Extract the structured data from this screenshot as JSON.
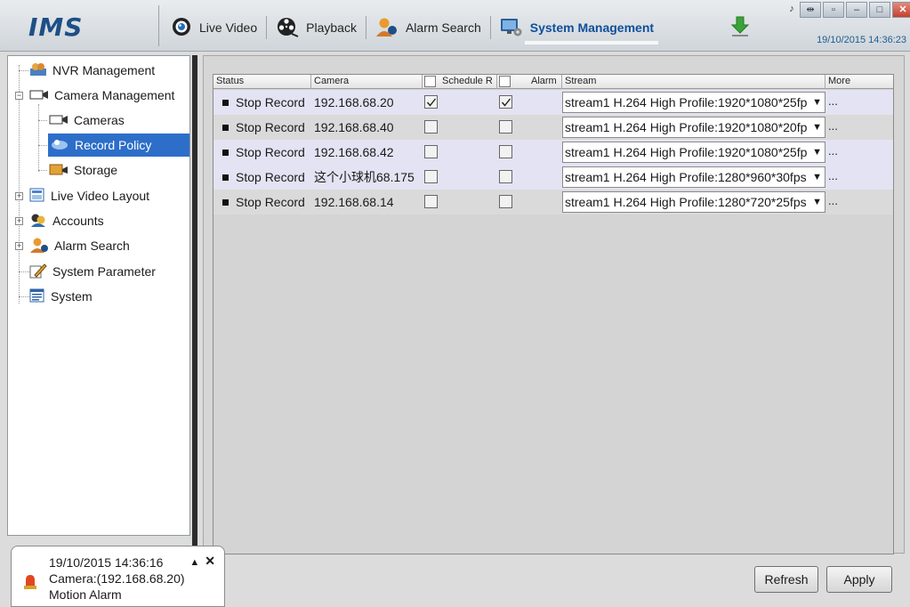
{
  "app": {
    "logo": "IMS",
    "datetime": "19/10/2015 14:36:23"
  },
  "nav": {
    "items": [
      {
        "label": "Live Video",
        "icon": "camera-eye-icon"
      },
      {
        "label": "Playback",
        "icon": "film-reel-icon"
      },
      {
        "label": "Alarm Search",
        "icon": "alarm-person-icon"
      },
      {
        "label": "System Management",
        "icon": "monitor-gear-icon",
        "active": true
      }
    ],
    "download_icon": "download-arrow-icon"
  },
  "window_controls": [
    "?",
    "▭▭",
    "▭",
    "–",
    "□",
    "X"
  ],
  "sidebar": {
    "items": [
      {
        "label": "NVR Management",
        "icon": "nvr-users-icon"
      },
      {
        "label": "Camera Management",
        "icon": "camera-icon",
        "expanded": true
      },
      {
        "label": "Cameras",
        "icon": "camera-icon"
      },
      {
        "label": "Record Policy",
        "icon": "record-policy-icon",
        "selected": true
      },
      {
        "label": "Storage",
        "icon": "storage-icon"
      },
      {
        "label": "Live Video Layout",
        "icon": "layout-icon"
      },
      {
        "label": "Accounts",
        "icon": "accounts-icon"
      },
      {
        "label": "Alarm Search",
        "icon": "alarm-person-icon"
      },
      {
        "label": "System Parameter",
        "icon": "pencil-icon"
      },
      {
        "label": "System",
        "icon": "system-window-icon"
      }
    ]
  },
  "table": {
    "headers": {
      "status": "Status",
      "camera": "Camera",
      "schedule": "Schedule R",
      "alarm": "Alarm",
      "stream": "Stream",
      "more": "More"
    },
    "rows": [
      {
        "status": "Stop Record",
        "camera": "192.168.68.20",
        "schedule": true,
        "alarm": true,
        "stream": "stream1 H.264 High Profile:1920*1080*25fp",
        "more": "..."
      },
      {
        "status": "Stop Record",
        "camera": "192.168.68.40",
        "schedule": false,
        "alarm": false,
        "stream": "stream1 H.264 High Profile:1920*1080*20fp",
        "more": "..."
      },
      {
        "status": "Stop Record",
        "camera": "192.168.68.42",
        "schedule": false,
        "alarm": false,
        "stream": "stream1 H.264 High Profile:1920*1080*25fp",
        "more": "..."
      },
      {
        "status": "Stop Record",
        "camera": "这个小球机68.175",
        "schedule": false,
        "alarm": false,
        "stream": "stream1 H.264 High Profile:1280*960*30fps",
        "more": "..."
      },
      {
        "status": "Stop Record",
        "camera": "192.168.68.14",
        "schedule": false,
        "alarm": false,
        "stream": "stream1 H.264 High Profile:1280*720*25fps",
        "more": "..."
      }
    ]
  },
  "buttons": {
    "refresh": "Refresh",
    "apply": "Apply"
  },
  "alarm_popup": {
    "time": "19/10/2015 14:36:16",
    "camera": "Camera:(192.168.68.20)",
    "message": "Motion Alarm",
    "controls": {
      "collapse": "▲",
      "close": "✕"
    }
  },
  "colors": {
    "accent": "#2d6ec9",
    "nav_active": "#0f4f9a",
    "row_alt": "#e3e3f3"
  }
}
